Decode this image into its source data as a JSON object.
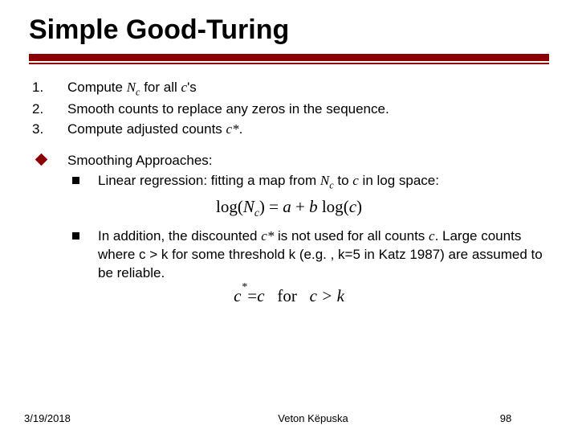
{
  "title": "Simple Good-Turing",
  "steps": [
    {
      "num": "1.",
      "pre": "Compute ",
      "sym": "N",
      "sub": "c",
      "mid": " for all ",
      "sym2": "c",
      "post": "'s"
    },
    {
      "num": "2.",
      "pre": "Smooth counts to replace any zeros in the sequence.",
      "sym": "",
      "sub": "",
      "mid": "",
      "sym2": "",
      "post": ""
    },
    {
      "num": "3.",
      "pre": "Compute adjusted counts ",
      "sym": "c*",
      "sub": "",
      "mid": ".",
      "sym2": "",
      "post": ""
    }
  ],
  "approach_heading": "Smoothing Approaches:",
  "sub1_a": "Linear regression: fitting a map from ",
  "sub1_N": "N",
  "sub1_c": "c",
  "sub1_b": " to ",
  "sub1_c2": "c",
  "sub1_d": " in log space:",
  "formula1": {
    "logN": "log",
    "N": "N",
    "c": "c",
    "eq": " = ",
    "a": "a",
    "plus": " + ",
    "b": "b",
    "logc": " log",
    "cc": "c",
    "lp": "(",
    "rp": ")"
  },
  "sub2_a": "In addition, the discounted ",
  "sub2_cs": "c*",
  "sub2_b": " is not used for all counts ",
  "sub2_c": "c",
  "sub2_d": ". Large counts where c > k for some threshold k (e.g. , k=5 in Katz 1987)  are assumed to be reliable.",
  "formula2": {
    "c": "c",
    "star": "*",
    "eq": " = ",
    "c2": "c",
    "for": "   for   ",
    "cgt": "c > k"
  },
  "footer": {
    "date": "3/19/2018",
    "author": "Veton Këpuska",
    "page": "98"
  }
}
